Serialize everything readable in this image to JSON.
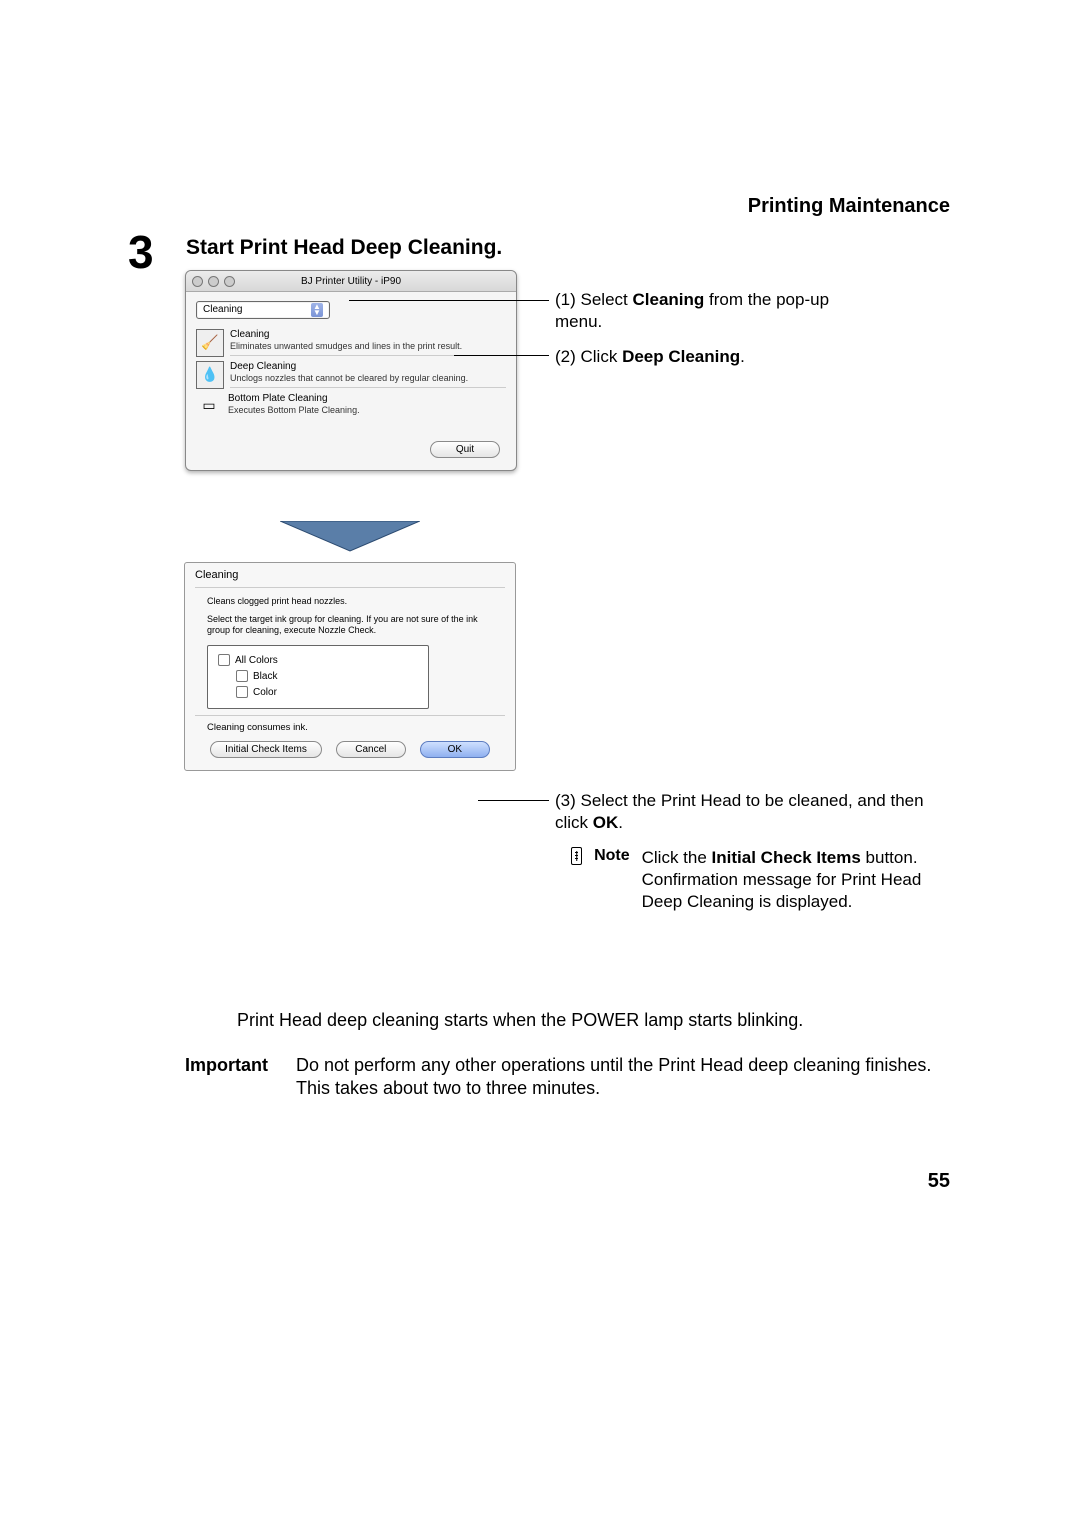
{
  "header": {
    "section": "Printing Maintenance"
  },
  "step": {
    "number": "3",
    "title": "Start Print Head Deep Cleaning."
  },
  "util_window": {
    "title": "BJ Printer Utility - iP90",
    "popup_value": "Cleaning",
    "items": [
      {
        "title": "Cleaning",
        "desc": "Eliminates unwanted smudges and lines in the print result."
      },
      {
        "title": "Deep Cleaning",
        "desc": "Unclogs nozzles that cannot be cleared by regular cleaning."
      },
      {
        "title": "Bottom Plate Cleaning",
        "desc": "Executes Bottom Plate Cleaning."
      }
    ],
    "quit": "Quit"
  },
  "callouts": {
    "c1_pre": "(1) Select ",
    "c1_bold": "Cleaning",
    "c1_post": " from the pop-up menu.",
    "c2_pre": "(2) Click ",
    "c2_bold": "Deep Cleaning",
    "c2_post": ".",
    "c3_pre": "(3) Select the Print Head to be cleaned, and then click ",
    "c3_bold": "OK",
    "c3_post": "."
  },
  "dialog2": {
    "title": "Cleaning",
    "line1": "Cleans clogged print head nozzles.",
    "line2": "Select the target ink group for cleaning. If you are not sure of the ink group for cleaning, execute Nozzle Check.",
    "opt_all": "All Colors",
    "opt_black": "Black",
    "opt_color": "Color",
    "consumes": "Cleaning consumes ink.",
    "btn_initial": "Initial Check Items",
    "btn_cancel": "Cancel",
    "btn_ok": "OK"
  },
  "note": {
    "label": "Note",
    "pre": "Click the ",
    "b1": "Initial Check Items",
    "mid": " button. Confirmation message for Print Head Deep Cleaning is displayed."
  },
  "body": {
    "line1": "Print Head deep cleaning starts when the POWER lamp starts blinking.",
    "important_label": "Important",
    "important_text": "Do not perform any other operations until the Print Head deep cleaning finishes. This takes about two to three minutes."
  },
  "page_number": "55"
}
